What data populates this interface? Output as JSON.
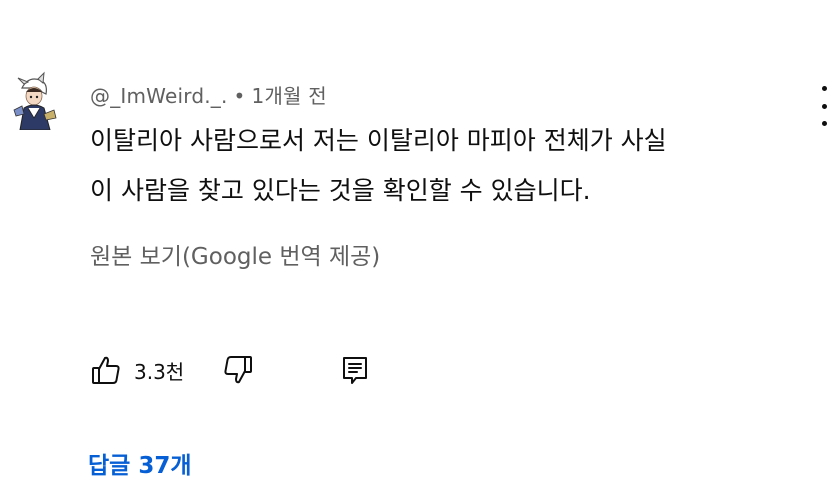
{
  "comment": {
    "author": "@_ImWeird._.",
    "separator": "•",
    "time": "1개월 전",
    "text_lines": [
      "이탈리아 사람으로서 저는 이탈리아 마피아 전체가 사실",
      "이 사람을 찾고 있다는 것을 확인할 수 있습니다."
    ],
    "translate_label": "원본 보기(Google 번역 제공)",
    "like_count": "3.3천",
    "replies_label": "답글 37개"
  },
  "icons": {
    "avatar": "anime-character-avatar",
    "menu": "more-vert-icon",
    "like": "thumbs-up-icon",
    "dislike": "thumbs-down-icon",
    "reply": "comment-reply-icon"
  },
  "colors": {
    "text": "#0f0f0f",
    "secondary": "#606060",
    "link": "#065fd4"
  }
}
